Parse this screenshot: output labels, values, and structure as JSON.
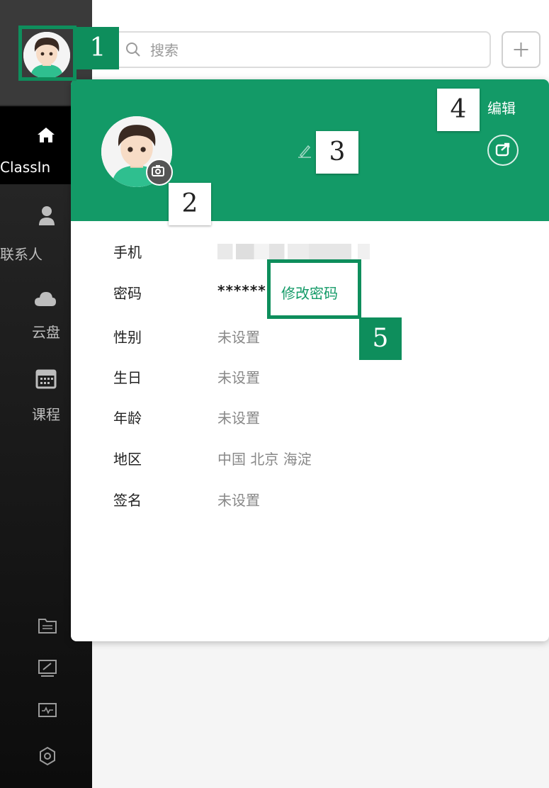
{
  "sidebar": {
    "items": [
      {
        "label": "ClassIn",
        "icon": "home-icon"
      },
      {
        "label": "联系人",
        "icon": "contact-icon"
      },
      {
        "label": "云盘",
        "icon": "cloud-icon"
      },
      {
        "label": "课程",
        "icon": "calendar-icon"
      }
    ],
    "tools": [
      "folder-icon",
      "whiteboard-icon",
      "monitor-icon",
      "settings-icon"
    ]
  },
  "search": {
    "placeholder": "搜索"
  },
  "profile": {
    "edit_label": "编辑",
    "fields": [
      {
        "key": "手机",
        "value": ""
      },
      {
        "key": "密码",
        "value": "******",
        "action": "修改密码"
      },
      {
        "key": "性别",
        "value": "未设置"
      },
      {
        "key": "生日",
        "value": "未设置"
      },
      {
        "key": "年龄",
        "value": "未设置"
      },
      {
        "key": "地区",
        "value": "中国 北京 海淀"
      },
      {
        "key": "签名",
        "value": "未设置"
      }
    ]
  },
  "callouts": [
    "1",
    "2",
    "3",
    "4",
    "5"
  ],
  "colors": {
    "accent": "#139a67",
    "sidebar": "#1f1f1f"
  }
}
